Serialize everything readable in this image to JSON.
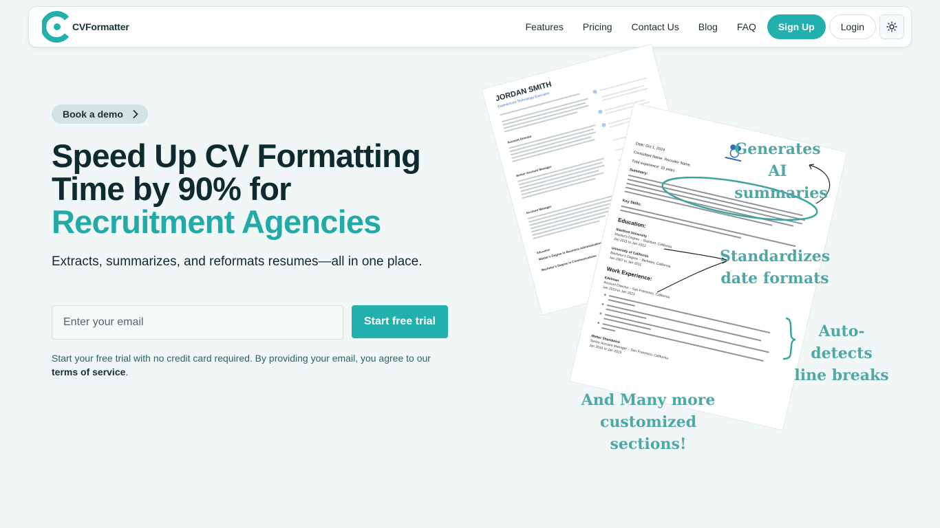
{
  "brand": {
    "name": "CVFormatter",
    "primary": "#22b0ad",
    "dark": "#0d2a2e"
  },
  "nav": {
    "links": [
      "Features",
      "Pricing",
      "Contact Us",
      "Blog",
      "FAQ"
    ],
    "signup": "Sign Up",
    "login": "Login",
    "theme_icon": "sun-icon"
  },
  "hero": {
    "pill": "Book a demo",
    "headline_line1": "Speed Up CV Formatting",
    "headline_line2": "Time by 90% for",
    "headline_accent": "Recruitment Agencies",
    "subhead": "Extracts, summarizes, and reformats resumes—all in one place.",
    "email_placeholder": "Enter your email",
    "cta": "Start free trial",
    "fineprint_before": "Start your free trial with no credit card required. By providing your email, you agree to our ",
    "fineprint_link": "terms of service",
    "fineprint_after": "."
  },
  "illustration": {
    "back_doc": {
      "name": "JORDAN SMITH",
      "role": "Experienced Technology Executive",
      "sections": [
        "Account Director",
        "Senior Account Manager",
        "Account Manager",
        "Education",
        "Master's Degree in Business Administration",
        "Bachelor's Degree in Communications"
      ]
    },
    "front_doc": {
      "date": "Date: Oct 1, 2024",
      "consultant": "Consultant Name: Recruiter Name",
      "experience": "Total experience: 10 years",
      "summary_label": "Summary:",
      "skills_label": "Key Skills:",
      "education_label": "Education:",
      "edu1": "Stanford University",
      "edu1_degree": "Master's Degree – Stanford, California",
      "edu1_dates": "Jan 2011 to Jan 2013",
      "edu2": "University of California",
      "edu2_degree": "Bachelor's Degree – Berkeley, California",
      "edu2_dates": "Jan 2007 to Jan 2011",
      "work_label": "Work Experience:",
      "job1": "Edelman",
      "job1_title": "Account Director – San Francisco, California",
      "job1_dates": "Jan 2019 to Jan 2023",
      "job2": "Weber Shandwick",
      "job2_title": "Senior Account Manager – San Francisco, California",
      "job2_dates": "Jan 2016 to Jan 2019"
    },
    "annotations": {
      "ai_line1": "Generates  AI",
      "ai_line2": "summaries",
      "date_line1": "Standardizes",
      "date_line2": "date formats",
      "break_line1": "Auto-detects",
      "break_line2": "line breaks",
      "more_line1": "And Many more customized",
      "more_line2": "sections!"
    }
  }
}
